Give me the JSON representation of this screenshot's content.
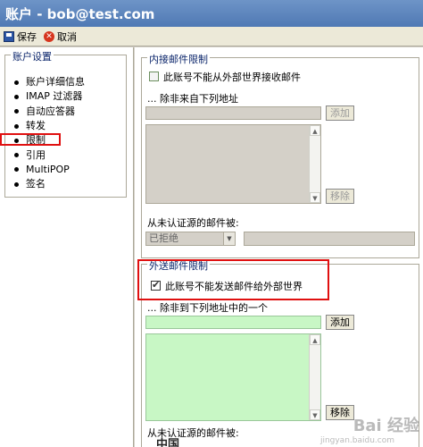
{
  "window": {
    "title": "账户 - bob@test.com"
  },
  "toolbar": {
    "save_label": "保存",
    "cancel_label": "取消"
  },
  "left": {
    "group_title": "账户设置",
    "items": [
      "账户详细信息",
      "IMAP 过滤器",
      "自动应答器",
      "转发",
      "限制",
      "引用",
      "MultiPOP",
      "签名"
    ]
  },
  "inbound": {
    "title": "内接邮件限制",
    "block_checkbox_label": "此账号不能从外部世界接收邮件",
    "except_label": "... 除非来自下列地址",
    "add_button": "添加",
    "remove_button": "移除",
    "unauth_label": "从未认证源的邮件被:",
    "unauth_select_value": "已拒绝"
  },
  "outbound": {
    "title": "外送邮件限制",
    "block_checkbox_label": "此账号不能发送邮件给外部世界",
    "except_label": "... 除非到下列地址中的一个",
    "add_button": "添加",
    "remove_button": "移除",
    "unauth_label": "从未认证源的邮件被:"
  },
  "watermark": {
    "text": "Bai 经验",
    "url": "jingyan.baidu.com"
  },
  "bottom_logo": "中国"
}
